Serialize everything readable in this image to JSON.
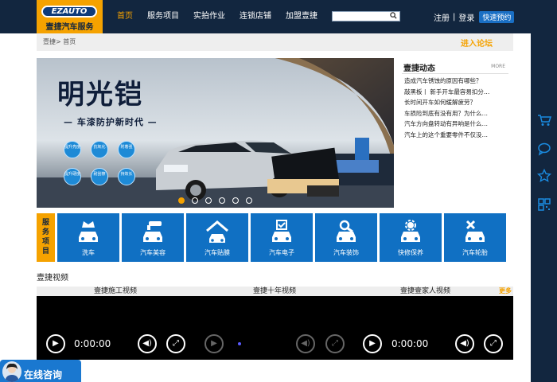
{
  "header": {
    "logo_text": "EZAUTO",
    "logo_sub": "壹捷汽车服务",
    "nav": [
      "首页",
      "服务项目",
      "实拍作业",
      "连锁店铺",
      "加盟壹捷"
    ],
    "search_placeholder": "",
    "register": "注册",
    "login": "登录",
    "book": "快速预约",
    "accent": "#f5a200",
    "bg": "#12263f"
  },
  "breadcrumb": {
    "text": "壹捷> 首页",
    "forum": "进入论坛"
  },
  "banner": {
    "title": "明光铠",
    "subtitle": "— 车漆防护新时代 —",
    "features": [
      "提升亮度",
      "抗氧化",
      "附着强",
      "提升硬度",
      "耐刮擦",
      "持效长"
    ],
    "slide_count": 6,
    "active_slide": 1
  },
  "news": {
    "title": "壹捷动态",
    "more": "MORE",
    "items": [
      "造成汽车锈蚀的原因有哪些？",
      "敲黑板丨 新手开车最容易扣分…",
      "长时间开车如何缓解疲劳？",
      "车损险到底有没有用？为什么…",
      "汽车方向盘转动有异响是什么…",
      "汽车上的这个重要零件不仅没…"
    ]
  },
  "services": {
    "label": "服务项目",
    "items": [
      {
        "name": "洗车",
        "icon": "car-wash-icon"
      },
      {
        "name": "汽车美容",
        "icon": "car-beauty-icon"
      },
      {
        "name": "汽车贴膜",
        "icon": "car-film-icon"
      },
      {
        "name": "汽车电子",
        "icon": "car-electronics-icon"
      },
      {
        "name": "汽车装饰",
        "icon": "car-decoration-icon"
      },
      {
        "name": "快修保养",
        "icon": "car-repair-icon"
      },
      {
        "name": "汽车轮胎",
        "icon": "car-tire-icon"
      }
    ]
  },
  "video": {
    "title": "壹捷视频",
    "tabs": [
      "壹捷施工视频",
      "壹捷十年视频",
      "壹捷壹家人视频"
    ],
    "more": "更多",
    "time_1": "0:00:00",
    "time_3": "0:00:00"
  },
  "consult": {
    "text": "在线咨询"
  }
}
